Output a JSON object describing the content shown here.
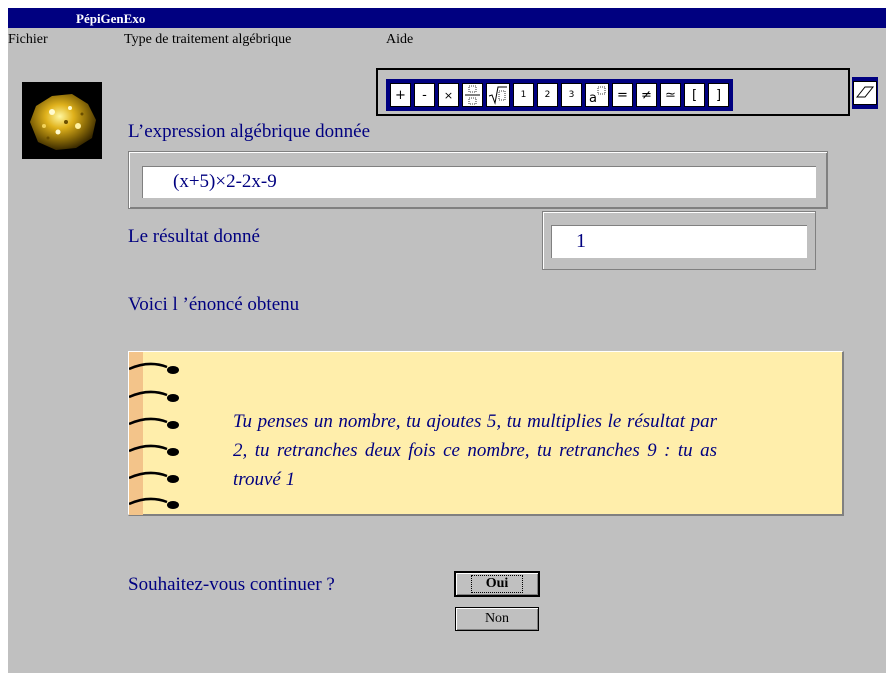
{
  "window": {
    "title": "PépiGenExo"
  },
  "menu": [
    {
      "label": "Fichier"
    },
    {
      "label": "Type de traitement algébrique"
    },
    {
      "label": "Aide"
    }
  ],
  "toolbar": {
    "buttons": [
      "+",
      "-",
      "×",
      "fraction",
      "√",
      "1",
      "2",
      "3",
      "a□",
      "=",
      "≠",
      "≃",
      "[",
      "]"
    ],
    "eraser_icon": "eraser-icon"
  },
  "expression": {
    "label": "L’expression algébrique donnée",
    "value": "(x+5)×2-2x-9"
  },
  "result": {
    "label": "Le résultat donné",
    "value": "1"
  },
  "statement": {
    "label": "Voici l ’énoncé obtenu",
    "text": "Tu penses un nombre, tu ajoutes 5, tu multiplies le résultat par 2, tu retranches deux fois ce nombre, tu retranches 9 : tu as trouvé 1"
  },
  "continue": {
    "question": "Souhaitez-vous continuer ?",
    "yes_label": "Oui",
    "no_label": "Non"
  },
  "colors": {
    "title_bar": "#000080",
    "text_blue": "#000080",
    "notebook": "#ffeeab",
    "window_bg": "#c0c0c0"
  }
}
